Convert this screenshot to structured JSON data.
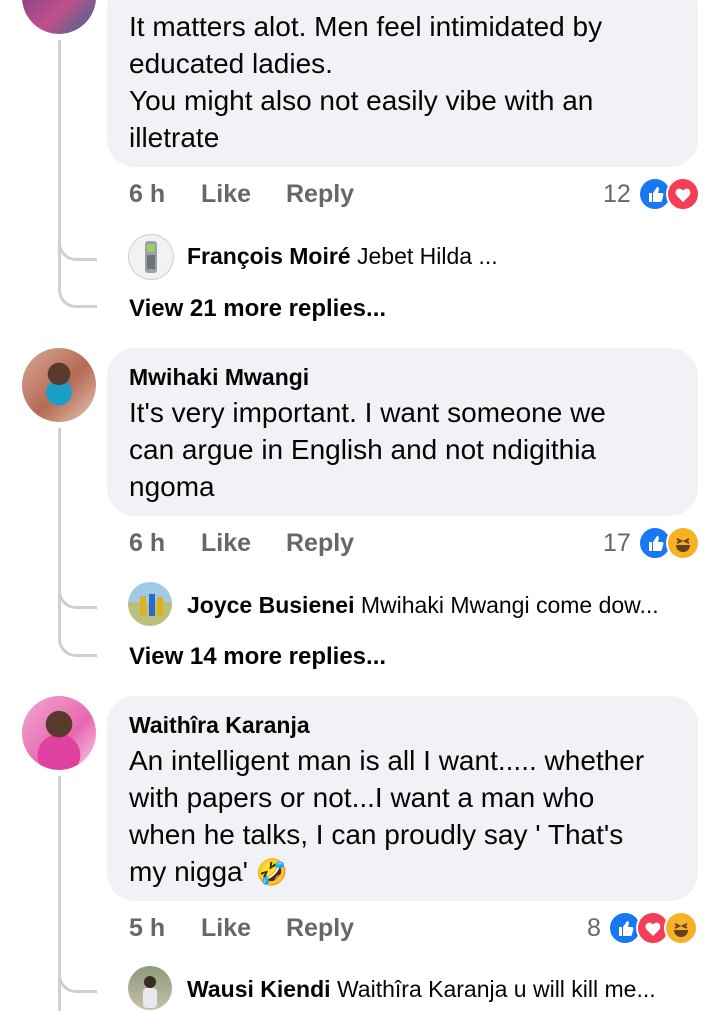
{
  "comments": [
    {
      "text": "It matters alot. Men feel intimidated by\neducated ladies.\nYou might also not easily vibe with an\nilletrate",
      "time": "6 h",
      "like": "Like",
      "reply": "Reply",
      "reaction_count": "12",
      "reactions": [
        "like-icon",
        "love-icon"
      ],
      "reply_preview": {
        "name": "François Moiré",
        "text": "Jebet Hilda ..."
      },
      "view_more": "View 21 more replies..."
    },
    {
      "name": "Mwihaki Mwangi",
      "text": "It's very important. I want someone we\ncan argue in English and not ndigithia\nngoma",
      "time": "6 h",
      "like": "Like",
      "reply": "Reply",
      "reaction_count": "17",
      "reactions": [
        "like-icon",
        "haha-icon"
      ],
      "reply_preview": {
        "name": "Joyce Busienei",
        "text": "Mwihaki Mwangi come dow..."
      },
      "view_more": "View 14 more replies..."
    },
    {
      "name": "Waithîra Karanja",
      "text": "An intelligent man is all I want..... whether\nwith papers or not...I want a man who\nwhen he talks, I can proudly say ' That's\nmy nigga'",
      "emoji": "🤣",
      "time": "5 h",
      "like": "Like",
      "reply": "Reply",
      "reaction_count": "8",
      "reactions": [
        "like-icon",
        "love-icon",
        "haha-icon"
      ],
      "reply_preview": {
        "name": "Wausi Kiendi",
        "text": "Waithîra Karanja u will kill me..."
      }
    }
  ],
  "colors": {
    "bubble": "#f0f2f5",
    "meta": "#65676b",
    "like": "#1877f2",
    "love": "#f33e58",
    "haha": "#f7b125"
  }
}
